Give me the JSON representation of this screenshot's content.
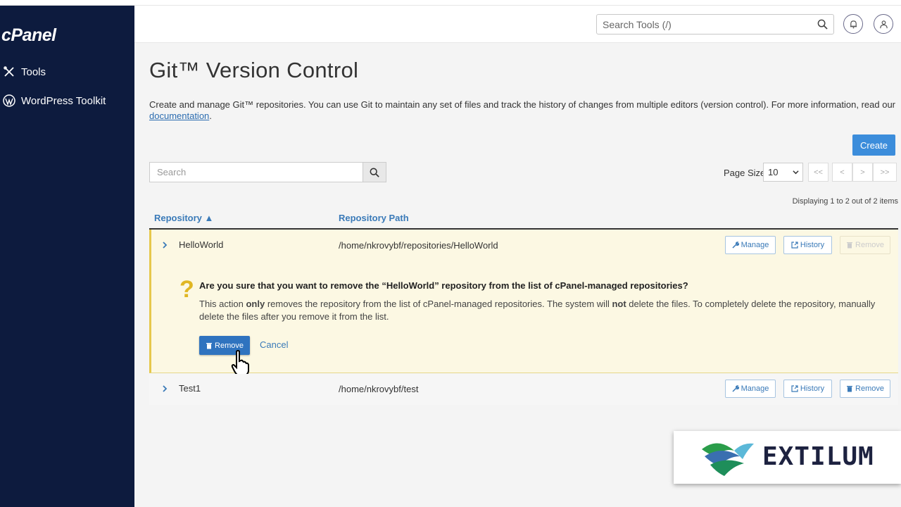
{
  "app": {
    "logo": "cPanel"
  },
  "sidebar": {
    "items": [
      {
        "label": "Tools",
        "icon": "tools-icon"
      },
      {
        "label": "WordPress Toolkit",
        "icon": "wordpress-icon"
      }
    ]
  },
  "header": {
    "search_placeholder": "Search Tools (/)",
    "bell_icon": "bell-icon",
    "user_icon": "user-icon"
  },
  "page": {
    "title": "Git™ Version Control",
    "description": "Create and manage Git™ repositories. You can use Git to maintain any set of files and track the history of changes from multiple editors (version control). For more information, read our",
    "doc_link": "documentation",
    "create_label": "Create"
  },
  "toolbar": {
    "search_placeholder": "Search",
    "page_size_label": "Page Size",
    "page_size_value": "10",
    "pager": [
      "<<",
      "<",
      ">",
      ">>"
    ],
    "displaying": "Displaying 1 to 2 out of 2 items"
  },
  "table": {
    "headers": {
      "repository": "Repository ▲",
      "path": "Repository Path"
    },
    "rows": [
      {
        "name": "HelloWorld",
        "path": "/home/nkrovybf/repositories/HelloWorld",
        "remove_disabled": true
      },
      {
        "name": "Test1",
        "path": "/home/nkrovybf/test",
        "remove_disabled": false
      }
    ],
    "actions": {
      "manage": "Manage",
      "history": "History",
      "remove": "Remove"
    }
  },
  "confirm": {
    "question": "Are you sure that you want to remove the “HelloWorld” repository from the list of cPanel-managed repositories?",
    "body_1": "This action ",
    "body_only": "only",
    "body_2": " removes the repository from the list of cPanel-managed repositories. The system will ",
    "body_not": "not",
    "body_3": " delete the files. To completely delete the repository, manually delete the files after you remove it from the list.",
    "remove_label": "Remove",
    "cancel_label": "Cancel"
  },
  "watermark": {
    "text": "EXTILUM"
  },
  "colors": {
    "sidebar": "#0d1b3e",
    "accent": "#3c8ddb",
    "warning_bg": "#fcf8e3",
    "question_mark": "#e0b623"
  }
}
